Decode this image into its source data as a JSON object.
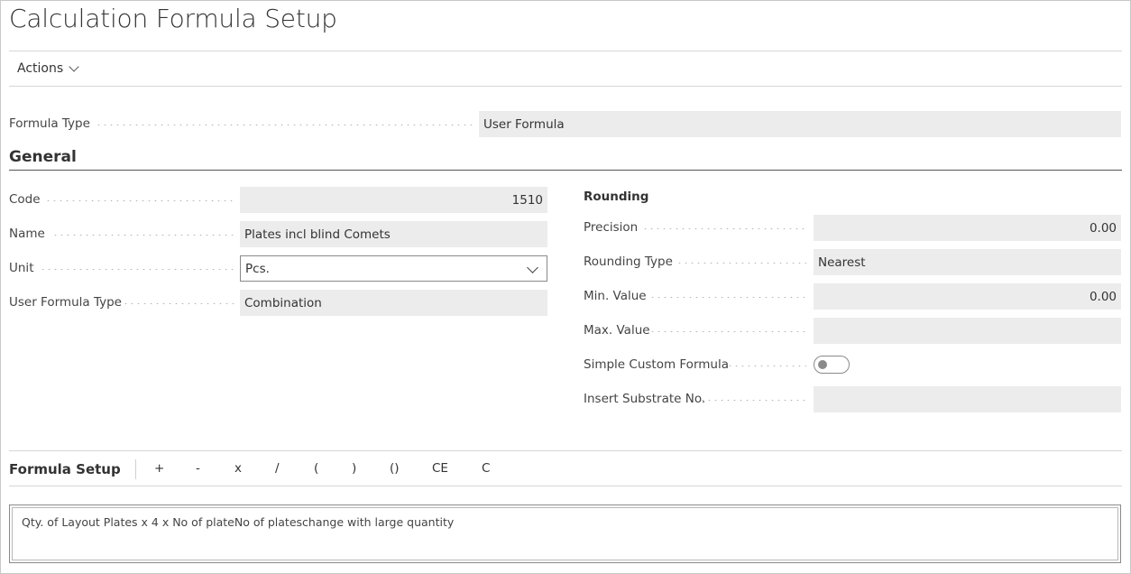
{
  "page": {
    "title": "Calculation Formula Setup"
  },
  "actions": {
    "label": "Actions"
  },
  "formula_type": {
    "label": "Formula Type",
    "value": "User Formula"
  },
  "general": {
    "title": "General",
    "code": {
      "label": "Code",
      "value": "1510"
    },
    "name": {
      "label": "Name",
      "value": "Plates incl blind Comets"
    },
    "unit": {
      "label": "Unit",
      "value": "Pcs."
    },
    "user_formula_type": {
      "label": "User Formula Type",
      "value": "Combination"
    }
  },
  "rounding": {
    "title": "Rounding",
    "precision": {
      "label": "Precision",
      "value": "0.00"
    },
    "rounding_type": {
      "label": "Rounding Type",
      "value": "Nearest"
    },
    "min_value": {
      "label": "Min. Value",
      "value": "0.00"
    },
    "max_value": {
      "label": "Max. Value",
      "value": ""
    },
    "simple_custom_formula": {
      "label": "Simple Custom Formula",
      "checked": false
    },
    "insert_substrate_no": {
      "label": "Insert Substrate No.",
      "value": ""
    }
  },
  "formula_setup": {
    "title": "Formula Setup",
    "operators": [
      "+",
      "-",
      "x",
      "/",
      "(",
      ")",
      "()",
      "CE",
      "C"
    ],
    "formula_text": "Qty. of Layout Plates x 4 x No of plateNo of plateschange with large quantity"
  }
}
